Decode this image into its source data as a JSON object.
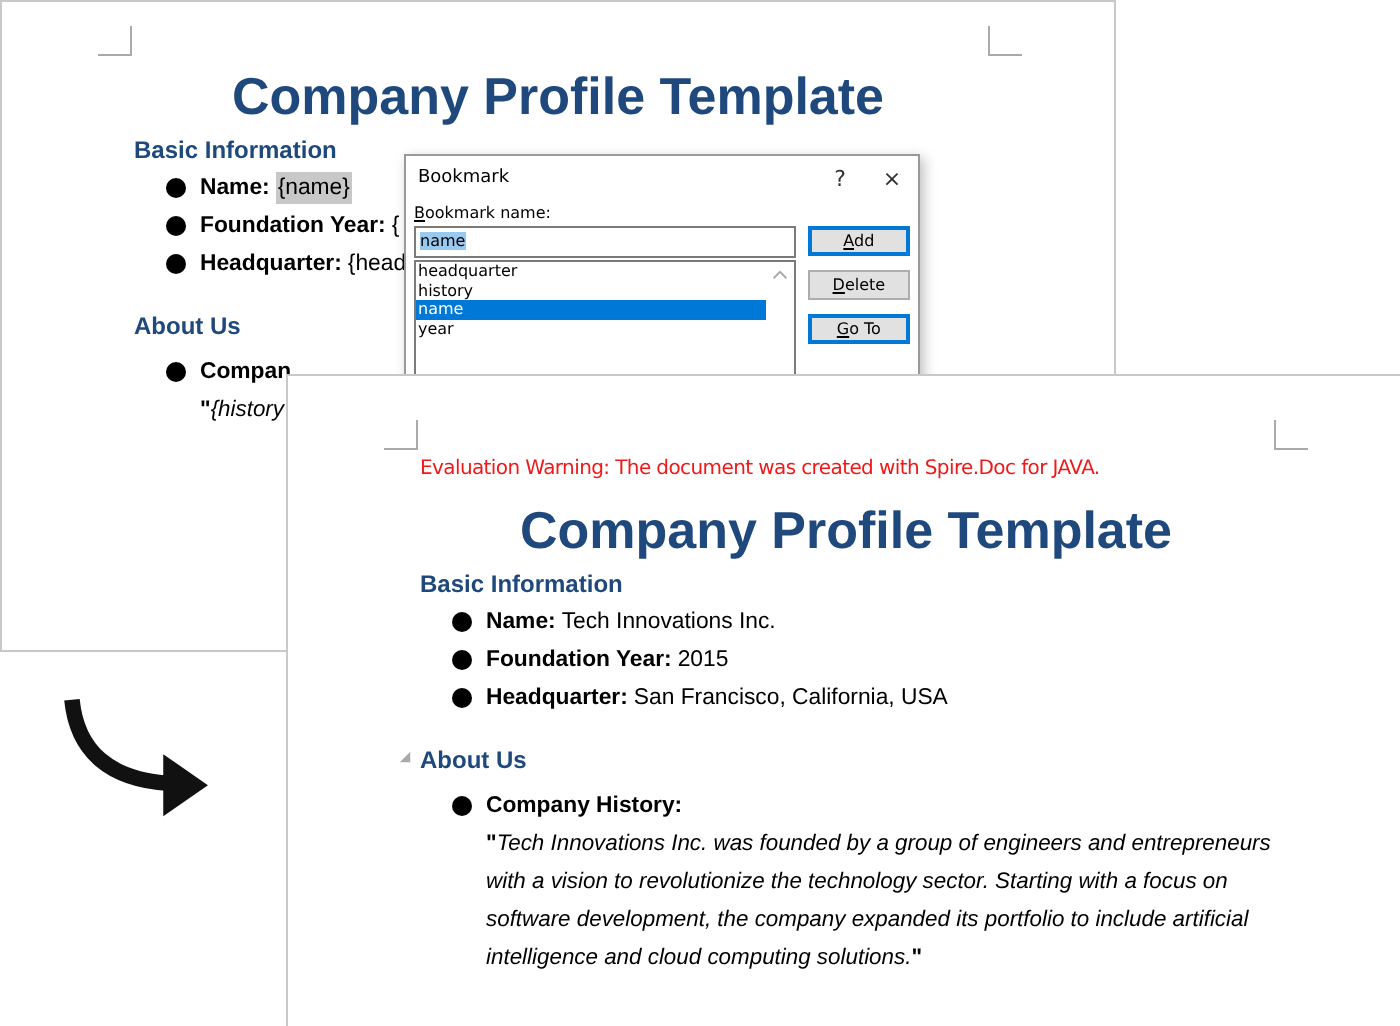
{
  "back_page": {
    "title": "Company Profile Template",
    "sections": [
      {
        "heading": "Basic Information",
        "collapsible": false,
        "items": [
          {
            "label": "Name:",
            "value": "{name}",
            "highlighted": true
          },
          {
            "label": "Foundation Year:",
            "value": "{",
            "highlighted": false
          },
          {
            "label": "Headquarter:",
            "value": "{head",
            "highlighted": false
          }
        ]
      },
      {
        "heading": "About Us",
        "collapsible": false,
        "items": [
          {
            "label": "Compan",
            "highlighted": false
          }
        ],
        "quote": {
          "open": "\"",
          "text": "{history"
        }
      }
    ]
  },
  "dialog": {
    "title": "Bookmark",
    "help": "?",
    "close": "×",
    "name_label": "Bookmark name:",
    "name_value": "name",
    "bookmarks": [
      {
        "name": "headquarter",
        "selected": false
      },
      {
        "name": "history",
        "selected": false
      },
      {
        "name": "name",
        "selected": true
      },
      {
        "name": "year",
        "selected": false
      }
    ],
    "buttons": [
      {
        "label": "Add",
        "focused": true
      },
      {
        "label": "Delete",
        "focused": false
      },
      {
        "label": "Go To",
        "focused": true
      }
    ]
  },
  "front_page": {
    "warning": "Evaluation Warning: The document was created with Spire.Doc for JAVA.",
    "title": "Company Profile Template",
    "sections": [
      {
        "heading": "Basic Information",
        "collapsible": false,
        "items": [
          {
            "label": "Name:",
            "value": "Tech Innovations Inc.",
            "highlighted": false
          },
          {
            "label": "Foundation Year:",
            "value": "2015",
            "highlighted": false
          },
          {
            "label": "Headquarter:",
            "value": "San Francisco, California, USA",
            "highlighted": false
          }
        ]
      },
      {
        "heading": "About Us",
        "collapsible": true,
        "items": [
          {
            "label": "Company History:",
            "highlighted": false
          }
        ],
        "quote": {
          "open": "\"",
          "text": "Tech Innovations Inc. was founded by a group of engineers and entrepreneurs with a vision to revolutionize the technology sector. Starting with a focus on software development, the company expanded its portfolio to include artificial intelligence and cloud computing solutions.",
          "close": "\""
        }
      }
    ]
  }
}
